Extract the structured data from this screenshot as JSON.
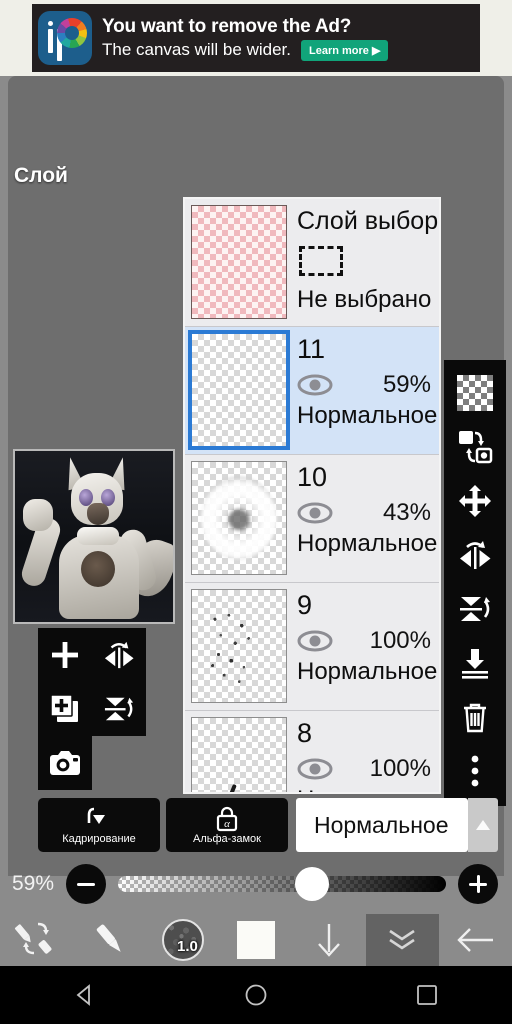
{
  "ad": {
    "logo_name": "ibispaint-logo-icon",
    "headline": "You want to remove the Ad?",
    "subline": "The canvas will be wider.",
    "cta_label": "Learn more ▶"
  },
  "panel": {
    "title": "Слой"
  },
  "layers": [
    {
      "name": "Слой выбора",
      "thumb_type": "pink-checker",
      "marquee_icon": "selection-marquee-icon",
      "status": "Не выбрано",
      "selected": false,
      "is_selection_layer": true
    },
    {
      "name": "11",
      "thumb_type": "empty-checker",
      "eye_icon": "eye-icon",
      "opacity": "59%",
      "blend": "Нормальное",
      "selected": true,
      "is_selection_layer": false
    },
    {
      "name": "10",
      "thumb_type": "blob",
      "eye_icon": "eye-icon",
      "opacity": "43%",
      "blend": "Нормальное",
      "selected": false,
      "is_selection_layer": false
    },
    {
      "name": "9",
      "thumb_type": "specks",
      "eye_icon": "eye-icon",
      "opacity": "100%",
      "blend": "Нормальное",
      "selected": false,
      "is_selection_layer": false
    },
    {
      "name": "8",
      "thumb_type": "stroke",
      "eye_icon": "eye-icon",
      "opacity": "100%",
      "blend": "Нормальное",
      "selected": false,
      "is_selection_layer": false
    }
  ],
  "right_toolbar": [
    {
      "icon": "transparency-checker-icon"
    },
    {
      "icon": "swap-layer-icon"
    },
    {
      "icon": "move-layer-icon"
    },
    {
      "icon": "flip-horizontal-icon"
    },
    {
      "icon": "flip-vertical-icon"
    },
    {
      "icon": "merge-down-icon"
    },
    {
      "icon": "delete-layer-icon"
    },
    {
      "icon": "more-options-icon"
    }
  ],
  "left_toolbar": [
    {
      "icon": "add-layer-icon"
    },
    {
      "icon": "flip-horizontal-icon"
    },
    {
      "icon": "duplicate-layer-icon"
    },
    {
      "icon": "flip-vertical-icon"
    },
    {
      "icon": "camera-import-icon"
    }
  ],
  "options": {
    "crop_label": "Кадрирование",
    "crop_icon": "crop-rotate-icon",
    "alpha_lock_label": "Альфа-замок",
    "alpha_lock_icon": "alpha-lock-icon",
    "blend_mode_value": "Нормальное",
    "blend_arrow_icon": "chevron-up-icon"
  },
  "opacity": {
    "value_label": "59%",
    "value_percent": 59,
    "minus_icon": "minus-icon",
    "plus_icon": "plus-icon"
  },
  "bottom_toolbar": {
    "tools": [
      {
        "icon": "brush-eraser-swap-icon",
        "active": false
      },
      {
        "icon": "brush-icon",
        "active": false
      },
      {
        "icon": "brush-size-icon",
        "active": false
      },
      {
        "icon": "color-swatch-icon",
        "active": false
      },
      {
        "icon": "download-arrow-icon",
        "active": false
      },
      {
        "icon": "double-chevron-down-icon",
        "active": true
      },
      {
        "icon": "back-arrow-icon",
        "active": false
      }
    ],
    "brush_size_label": "1.0",
    "color_swatch_hex": "#fbfbf7"
  },
  "nav_bar": [
    {
      "icon": "android-back-icon"
    },
    {
      "icon": "android-home-icon"
    },
    {
      "icon": "android-recents-icon"
    }
  ],
  "colors": {
    "panel_bg": "#6e6e6e",
    "app_bg": "#8b8b8b",
    "selected_row": "#d3e3f7",
    "selection_border": "#2b7ad4",
    "cta_green": "#11a47a",
    "toolbar_black": "#0a0a0a"
  }
}
